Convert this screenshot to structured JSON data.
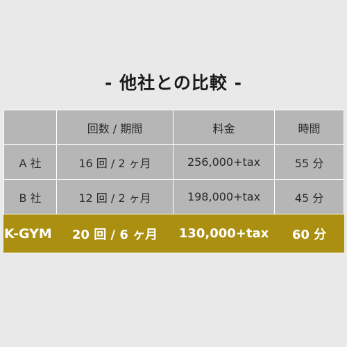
{
  "title": "- 他社との比較 -",
  "headers": [
    "",
    "回数 / 期間",
    "料金",
    "時間"
  ],
  "rows": [
    {
      "name": "A 社",
      "sessions": "16 回 / 2 ヶ月",
      "price": "256,000+tax",
      "time": "55 分"
    },
    {
      "name": "B 社",
      "sessions": "12 回 / 2 ヶ月",
      "price": "198,000+tax",
      "time": "45 分"
    }
  ],
  "highlight": {
    "name": "K-GYM",
    "sessions": "20 回 / 6 ヶ月",
    "price": "130,000+tax",
    "time": "60 分"
  },
  "colors": {
    "background": "#e9e9e9",
    "cell": "#b6b6b6",
    "highlight": "#ab8f10",
    "highlight_text": "#ffffff"
  }
}
